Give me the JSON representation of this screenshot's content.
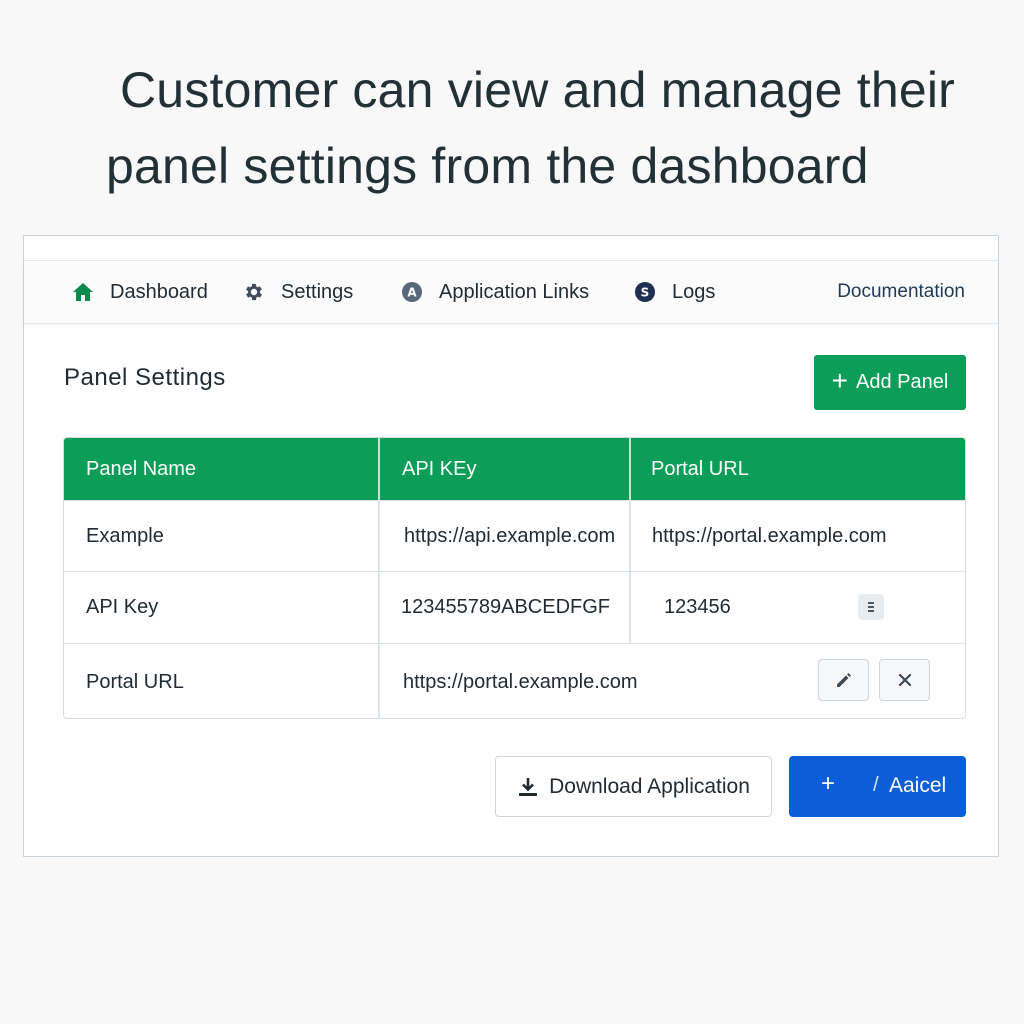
{
  "headline": {
    "line1": "Customer can view and manage their",
    "line2": "panel settings from the dashboard"
  },
  "nav": {
    "items": [
      {
        "label": "Dashboard",
        "icon": "home-icon"
      },
      {
        "label": "Settings",
        "icon": "gear-icon"
      },
      {
        "label": "Application Links",
        "icon": "app-links-icon",
        "badge": "A"
      },
      {
        "label": "Logs",
        "icon": "logs-icon",
        "badge": "S"
      }
    ],
    "documentation": "Documentation"
  },
  "section": {
    "title": "Panel Settings",
    "add_button": "Add Panel",
    "add_icon": "+"
  },
  "table": {
    "headers": [
      "Panel Name",
      "API KEy",
      "Portal URL"
    ],
    "rows": [
      [
        "Example",
        "https://api.example.com",
        "https://portal.example.com"
      ],
      [
        "API Key",
        "123455789ABCEDFGF",
        "123456"
      ],
      [
        "Portal URL",
        "https://portal.example.com",
        ""
      ]
    ]
  },
  "footer": {
    "download_label": "Download Application",
    "blue_plus": "+",
    "blue_slash": "/",
    "blue_label": "Aaicel"
  },
  "colors": {
    "accent_green": "#0c9d58",
    "accent_blue": "#0b5ed7",
    "nav_icon_dark": "#1e2f52"
  }
}
